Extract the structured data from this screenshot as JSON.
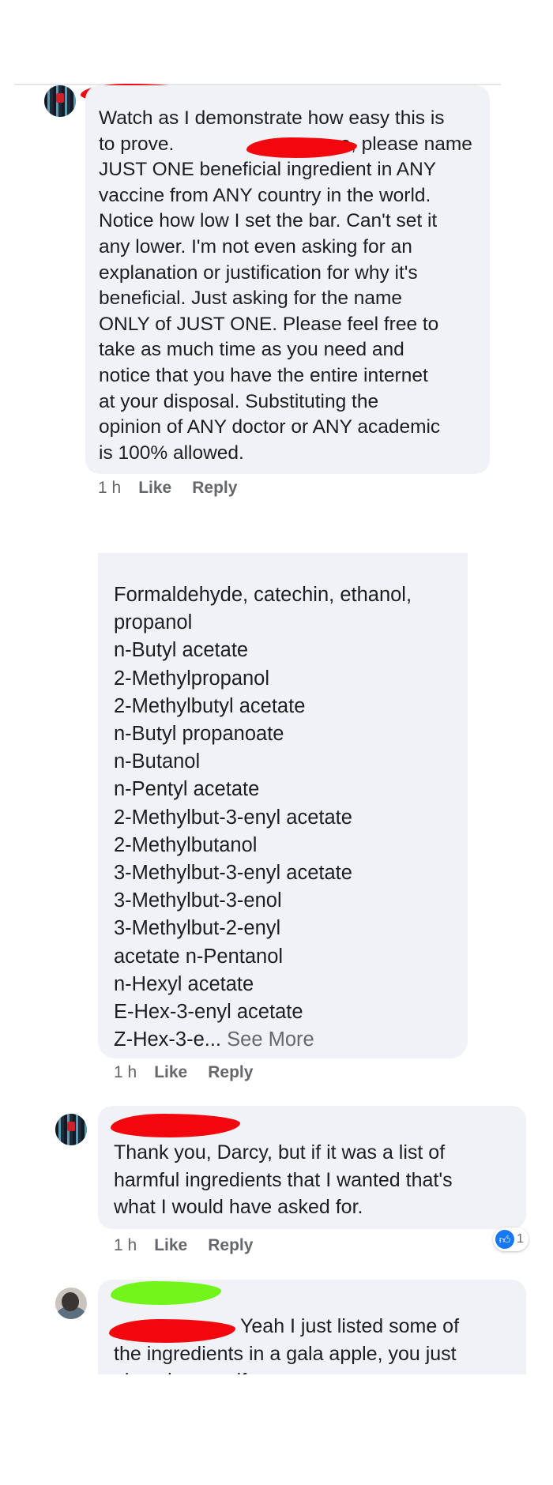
{
  "comment1": {
    "lines": [
      "Watch as I demonstrate how easy this is",
      "to prove.",
      "JUST ONE beneficial ingredient in ANY",
      "vaccine from ANY country in the world.",
      "Notice how low I set the bar. Can't set it",
      "any lower. I'm not even asking for an",
      "explanation or justification for why it's",
      "beneficial. Just asking for the name",
      "ONLY of JUST ONE. Please feel free to",
      "take as much time as you need and",
      "notice that you have the entire internet",
      "at your disposal. Substituting the",
      "opinion of ANY doctor or ANY academic",
      "is 100% allowed."
    ],
    "line2_tail": "e, please name",
    "time": "1 h",
    "like": "Like",
    "reply": "Reply"
  },
  "comment2": {
    "lines": [
      "Formaldehyde, catechin, ethanol,",
      "propanol",
      "n-Butyl acetate",
      "2-Methylpropanol",
      "2-Methylbutyl acetate",
      "n-Butyl propanoate",
      "n-Butanol",
      "n-Pentyl acetate",
      "2-Methylbut-3-enyl acetate",
      "2-Methylbutanol",
      "3-Methylbut-3-enyl acetate",
      "3-Methylbut-3-enol",
      "3-Methylbut-2-enyl",
      "acetate n-Pentanol",
      "n-Hexyl acetate",
      "E-Hex-3-enyl acetate"
    ],
    "last_line": "Z-Hex-3-e...",
    "see_more": "See More",
    "time": "1 h",
    "like": "Like",
    "reply": "Reply"
  },
  "comment3": {
    "lines": [
      "Thank you, Darcy, but if it was a list of",
      "harmful ingredients that I wanted that's",
      "what I would have asked for."
    ],
    "time": "1 h",
    "like": "Like",
    "reply": "Reply",
    "reaction_count": "1",
    "reaction_icon": "like-icon"
  },
  "comment4": {
    "first_line_tail": "Yeah I just listed some of",
    "lines": [
      "the ingredients in a gala apple, you just",
      "played yourself."
    ]
  },
  "colors": {
    "bubble": "#f0f2f5",
    "meta_text": "#65676b",
    "redaction_red": "#f2070f",
    "redaction_green": "#71f51a",
    "like_blue": "#1877f2"
  }
}
